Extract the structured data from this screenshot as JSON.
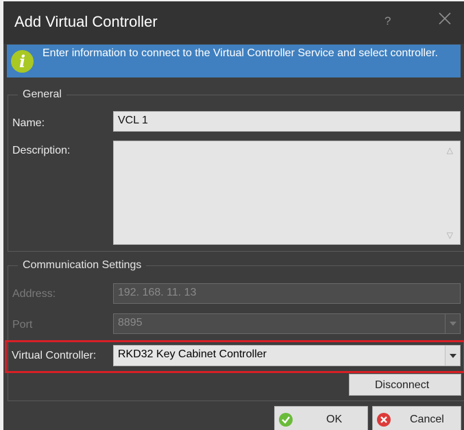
{
  "window": {
    "title": "Add Virtual Controller",
    "help_label": "?"
  },
  "info": {
    "text": "Enter information to connect to the Virtual Controller Service and select controller."
  },
  "general": {
    "title": "General",
    "name_label": "Name:",
    "name_value": "VCL 1",
    "description_label": "Description:",
    "description_value": ""
  },
  "communication": {
    "title": "Communication Settings",
    "address_label": "Address:",
    "address_value": "192. 168. 11. 13",
    "port_label": "Port",
    "port_value": "8895",
    "controller_label": "Virtual Controller:",
    "controller_value": "RKD32 Key Cabinet Controller",
    "disconnect_label": "Disconnect"
  },
  "buttons": {
    "ok_label": "OK",
    "cancel_label": "Cancel"
  },
  "colors": {
    "accent": "#4080c0",
    "highlight": "#d81f26",
    "ok_badge": "#6abb3a",
    "cancel_badge": "#dd3a3a"
  }
}
